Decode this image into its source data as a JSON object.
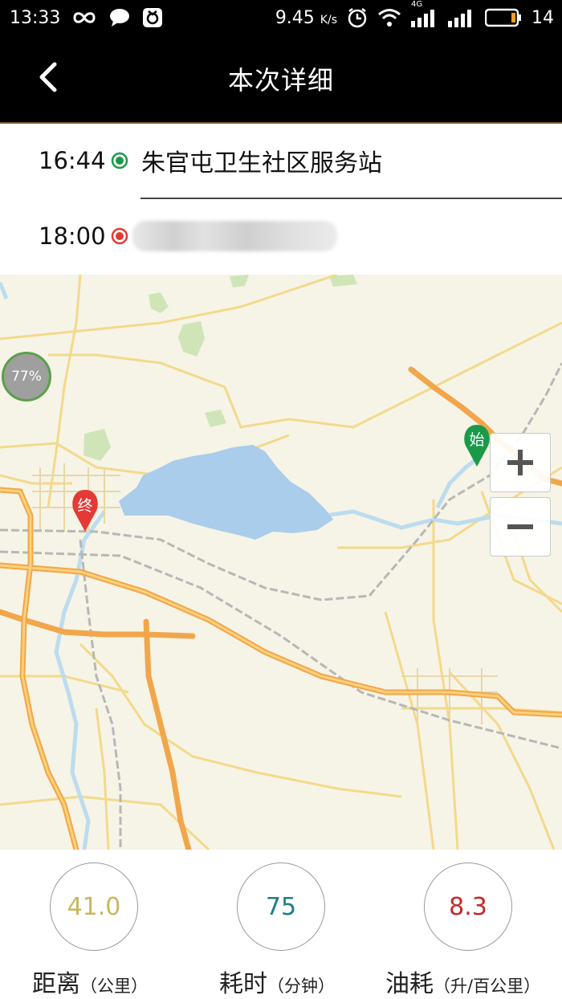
{
  "status_bar": {
    "time": "13:33",
    "net_speed_value": "9.45",
    "net_speed_unit": "K/s",
    "network_type": "4G",
    "battery_level": "14",
    "icons": [
      "infinity-icon",
      "chat-icon",
      "app-notification-icon",
      "alarm-icon",
      "wifi-icon",
      "signal-4g-icon",
      "signal-icon",
      "battery-icon"
    ]
  },
  "nav": {
    "title": "本次详细",
    "back_icon": "chevron-left-icon"
  },
  "route": {
    "start": {
      "time": "16:44",
      "place": "朱官屯卫生社区服务站",
      "dot_color": "#1a9a48"
    },
    "end": {
      "time": "18:00",
      "place_blurred": true,
      "dot_color": "#e53935"
    }
  },
  "map": {
    "start_marker_label": "始",
    "end_marker_label": "终",
    "battery_badge": "77%",
    "zoom_in_icon": "plus-icon",
    "zoom_out_icon": "minus-icon",
    "colors": {
      "land": "#f6f4e6",
      "water": "#a9cdea",
      "highway": "#f2a64b",
      "road": "#f3d98c",
      "rail": "#b7b7b7",
      "river": "#bcdcef",
      "park": "#cfe5b8"
    }
  },
  "stats": [
    {
      "value": "41.0",
      "name": "距离",
      "unit": "（公里）",
      "color": "#c9b75a"
    },
    {
      "value": "75",
      "name": "耗时",
      "unit": "（分钟）",
      "color": "#1f7d8a"
    },
    {
      "value": "8.3",
      "name": "油耗",
      "unit": "（升/百公里）",
      "color": "#c62828"
    }
  ]
}
